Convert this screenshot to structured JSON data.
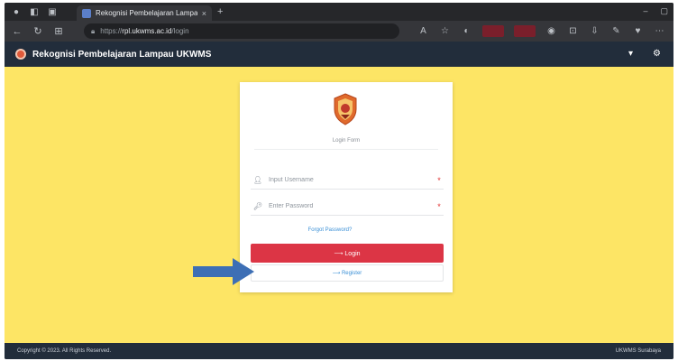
{
  "browser": {
    "tab_title": "Rekognisi Pembelajaran Lampau UKWMS",
    "tab_close": "×",
    "new_tab": "+",
    "url_prefix": "https://",
    "url_domain": "rpl.ukwms.ac.id",
    "url_path": "/login"
  },
  "app": {
    "title": "Rekognisi Pembelajaran Lampau UKWMS"
  },
  "login": {
    "caption": "Login Form",
    "username_placeholder": "Input Username",
    "password_placeholder": "Enter Password",
    "required_mark": "*",
    "forgot_label": "Forgot Password?",
    "login_label": "⟶ Login",
    "register_label": "⟶ Register"
  },
  "footer": {
    "left": "Copyright © 2023. All Rights Reserved.",
    "right": "UKWMS Surabaya"
  },
  "colors": {
    "page_background": "#fde565",
    "header_background": "#222d3b",
    "login_button": "#dc3545",
    "link": "#3a8fd6",
    "annotation_arrow": "#3d6fb5"
  },
  "icons": {
    "browser_back": "arrow-left-icon",
    "browser_refresh": "refresh-icon",
    "username_field": "user-icon",
    "password_field": "key-icon",
    "header_right": [
      "bell-icon",
      "settings-icon"
    ]
  }
}
